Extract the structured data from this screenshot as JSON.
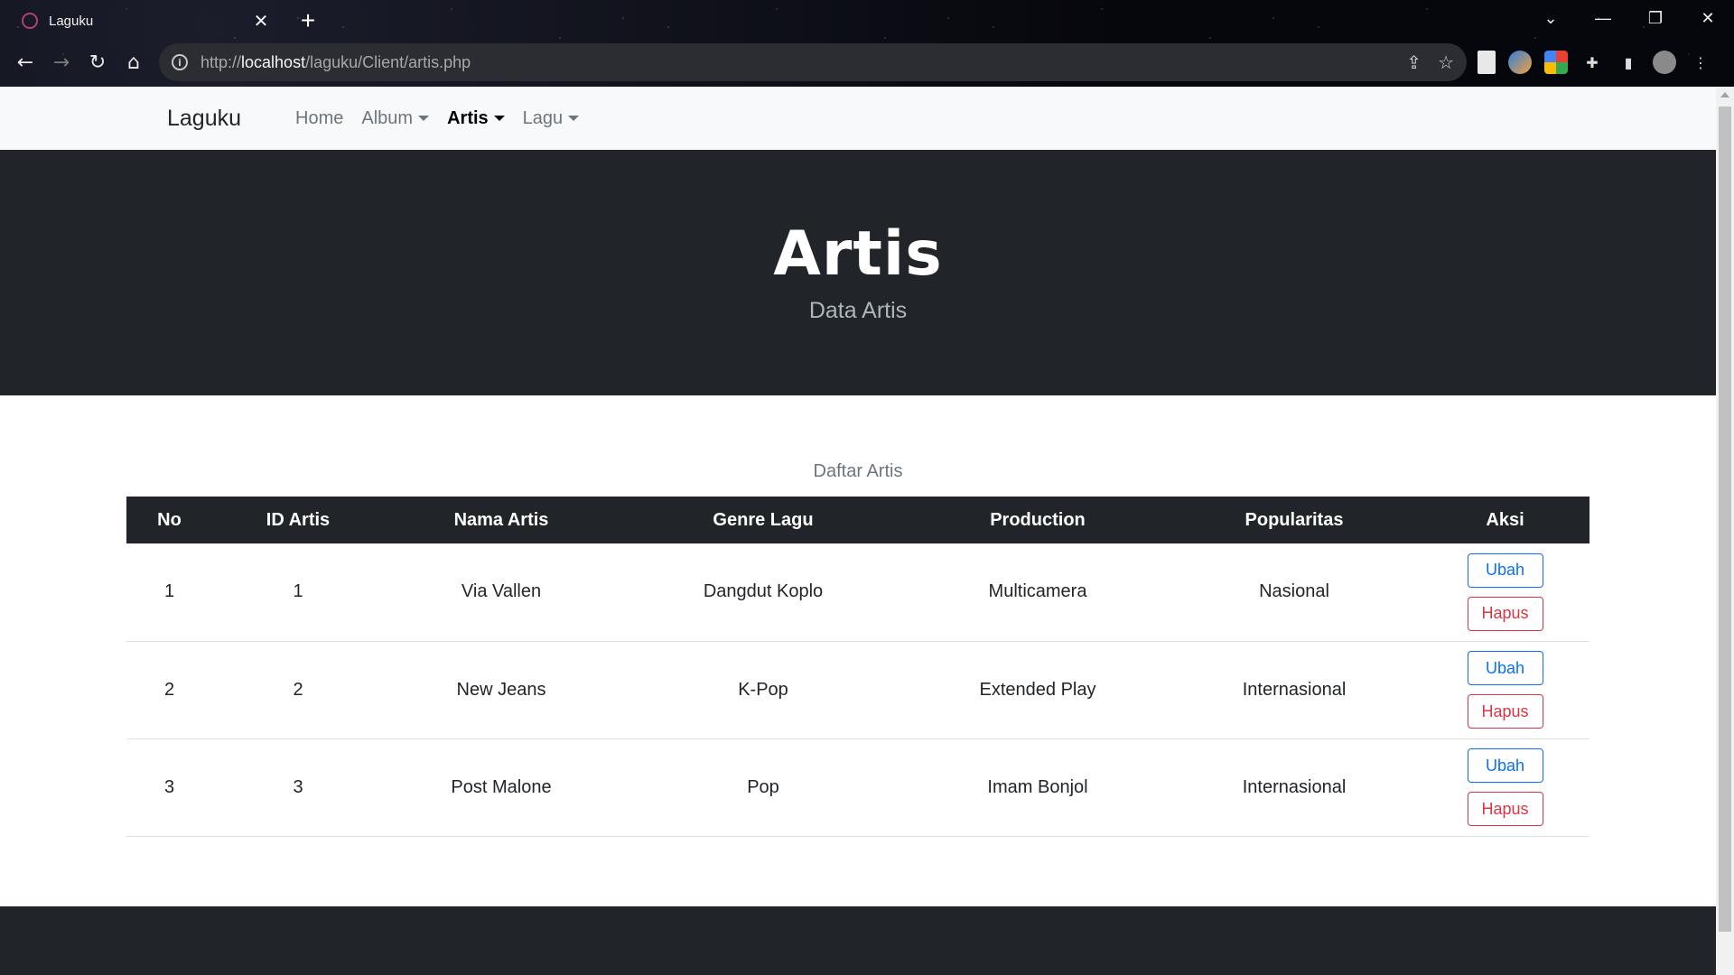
{
  "browser": {
    "tab_title": "Laguku",
    "tab_close": "✕",
    "new_tab": "+",
    "url_prefix": "http://",
    "url_host": "localhost",
    "url_path": "/laguku/Client/artis.php"
  },
  "navbar": {
    "brand": "Laguku",
    "items": [
      {
        "label": "Home",
        "dropdown": false,
        "active": false
      },
      {
        "label": "Album",
        "dropdown": true,
        "active": false
      },
      {
        "label": "Artis",
        "dropdown": true,
        "active": true
      },
      {
        "label": "Lagu",
        "dropdown": true,
        "active": false
      }
    ]
  },
  "hero": {
    "title": "Artis",
    "subtitle": "Data Artis"
  },
  "table": {
    "caption": "Daftar Artis",
    "headers": [
      "No",
      "ID Artis",
      "Nama Artis",
      "Genre Lagu",
      "Production",
      "Popularitas",
      "Aksi"
    ],
    "rows": [
      {
        "no": "1",
        "id": "1",
        "nama": "Via Vallen",
        "genre": "Dangdut Koplo",
        "production": "Multicamera",
        "popularitas": "Nasional"
      },
      {
        "no": "2",
        "id": "2",
        "nama": "New Jeans",
        "genre": "K-Pop",
        "production": "Extended Play",
        "popularitas": "Internasional"
      },
      {
        "no": "3",
        "id": "3",
        "nama": "Post Malone",
        "genre": "Pop",
        "production": "Imam Bonjol",
        "popularitas": "Internasional"
      }
    ],
    "edit_label": "Ubah",
    "delete_label": "Hapus"
  },
  "colors": {
    "dark": "#212529",
    "navbar_bg": "#f8f9fa",
    "primary": "#0d6efd",
    "danger": "#dc3545"
  },
  "icons": [
    "back-arrow-icon",
    "forward-arrow-icon",
    "reload-icon",
    "home-icon",
    "info-icon",
    "share-icon",
    "bookmark-star-icon",
    "extensions-icon",
    "side-panel-icon",
    "menu-dots-icon"
  ]
}
